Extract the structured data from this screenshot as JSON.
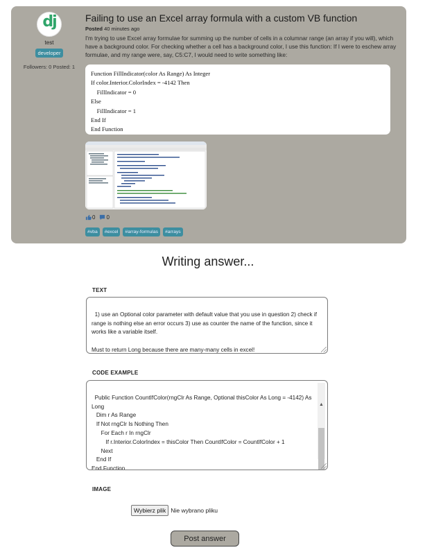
{
  "question": {
    "author": {
      "name": "test",
      "role_badge": "developer",
      "stats": "Followers: 0 Posted: 1",
      "avatar_icon": "django-logo-icon"
    },
    "title": "Failing to use an Excel array formula with a custom VB function",
    "posted_label": "Posted",
    "posted_time": "40 minutes ago",
    "body": "I'm trying to use Excel array formulae for summing up the number of cells in a columnar range (an array if you will), which have a background color. For checking whether a cell has a background color, I use this function: If I were to eschew array formulae, and my range were, say, C5:C7, I would need to write something like:",
    "code": "Function FillIndicator(color As Range) As Integer\nIf color.Interior.ColorIndex = -4142 Then\n    FillIndicator = 0\nElse\n    FillIndicator = 1\nEnd If\nEnd Function",
    "screenshot_label": "screenshot-thumbnail",
    "likes": "0",
    "comments": "0",
    "tags": [
      "#vba",
      "#excel",
      "#array-formulas",
      "#arrays"
    ]
  },
  "answer_form": {
    "heading": "Writing answer...",
    "text_label": "TEXT",
    "text_value": "1) use an Optional color parameter with default value that you use in question 2) check if range is nothing else an error occurs 3) use as counter the name of the function, since it works like a variable itself.\n\nMust to return Long because there are many-many cells in excel!",
    "code_label": "CODE EXAMPLE",
    "code_value": "Public Function CountIfColor(rngClr As Range, Optional thisColor As Long = -4142) As Long\n   Dim r As Range\n   If Not rngClr Is Nothing Then\n      For Each r In rngClr\n         If r.Interior.ColorIndex = thisColor Then CountIfColor = CountIfColor + 1\n      Next\n   End If\nEnd Function",
    "image_label": "IMAGE",
    "file_button": "Wybierz plik",
    "file_status": "Nie wybrano pliku",
    "submit": "Post answer"
  }
}
